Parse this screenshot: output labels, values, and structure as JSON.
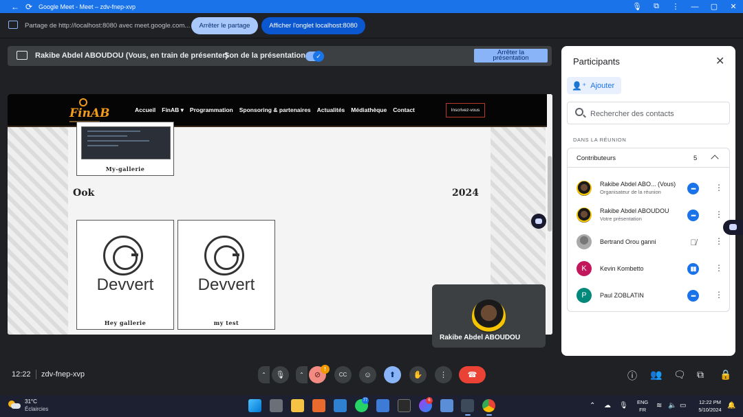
{
  "window": {
    "title": "Google Meet - Meet – zdv-fnep-xvp"
  },
  "share_bar": {
    "text": "Partage de http://localhost:8080 avec meet.google.com...",
    "stop_label": "Arrêter le partage",
    "show_tab_label": "Afficher l'onglet localhost:8080"
  },
  "presenting_bar": {
    "presenter_text": "Rakibe Abdel ABOUDOU (Vous, en train de présenter)",
    "sound_label": "Son de la présentation",
    "sound_enabled": true,
    "stop_line1": "Arrêter la",
    "stop_line2": "présentation"
  },
  "shared_site": {
    "logo_text": "FinAB",
    "nav": [
      "Accueil",
      "FinAB ▾",
      "Programmation",
      "Sponsoring & partenaires",
      "Actualités",
      "Médiathèque",
      "Contact"
    ],
    "cta_label": "Inscrivez-vous",
    "top_card_label": "My-gallerie",
    "left_word": "Ook",
    "right_word": "2024",
    "cards": [
      {
        "logo_text": "Devvert",
        "label": "Hey gallerie"
      },
      {
        "logo_text": "Devvert",
        "label": "my test"
      }
    ]
  },
  "self_tile": {
    "name": "Rakibe Abdel ABOUDOU"
  },
  "participants": {
    "title": "Participants",
    "add_label": "Ajouter",
    "search_placeholder": "Rechercher des contacts",
    "section_label": "DANS LA RÉUNION",
    "group_label": "Contributeurs",
    "group_count": "5",
    "people": [
      {
        "name": "Rakibe Abdel ABO...  (Vous)",
        "sub": "Organisateur de la réunion",
        "avatar": "photo",
        "status": "speaking-dots"
      },
      {
        "name": "Rakibe Abdel ABOUDOU",
        "sub": "Votre présentation",
        "avatar": "photo",
        "status": "speaking-dots"
      },
      {
        "name": "Bertrand Orou ganni",
        "sub": "",
        "avatar": "gray",
        "status": "muted"
      },
      {
        "name": "Kevin Kombetto",
        "sub": "",
        "avatar_letter": "K",
        "avatar_color": "#c2185b",
        "status": "speaking-bars"
      },
      {
        "name": "Paul ZOBLATIN",
        "sub": "",
        "avatar_letter": "P",
        "avatar_color": "#00897b",
        "status": "speaking-dots"
      }
    ]
  },
  "meeting_bar": {
    "time": "12:22",
    "code": "zdv-fnep-xvp",
    "camera_alert": "!"
  },
  "taskbar": {
    "temperature": "31°C",
    "condition": "Éclaircies",
    "whatsapp_badge": "77",
    "messenger_badge": "6",
    "lang_top": "ENG",
    "lang_bottom": "FR",
    "clock_time": "12:22 PM",
    "clock_date": "5/10/2024"
  },
  "colors": {
    "accent": "#1a73e8",
    "end_call": "#ea4335",
    "camera_off": "#f28b82",
    "site_orange": "#f29b1d"
  }
}
